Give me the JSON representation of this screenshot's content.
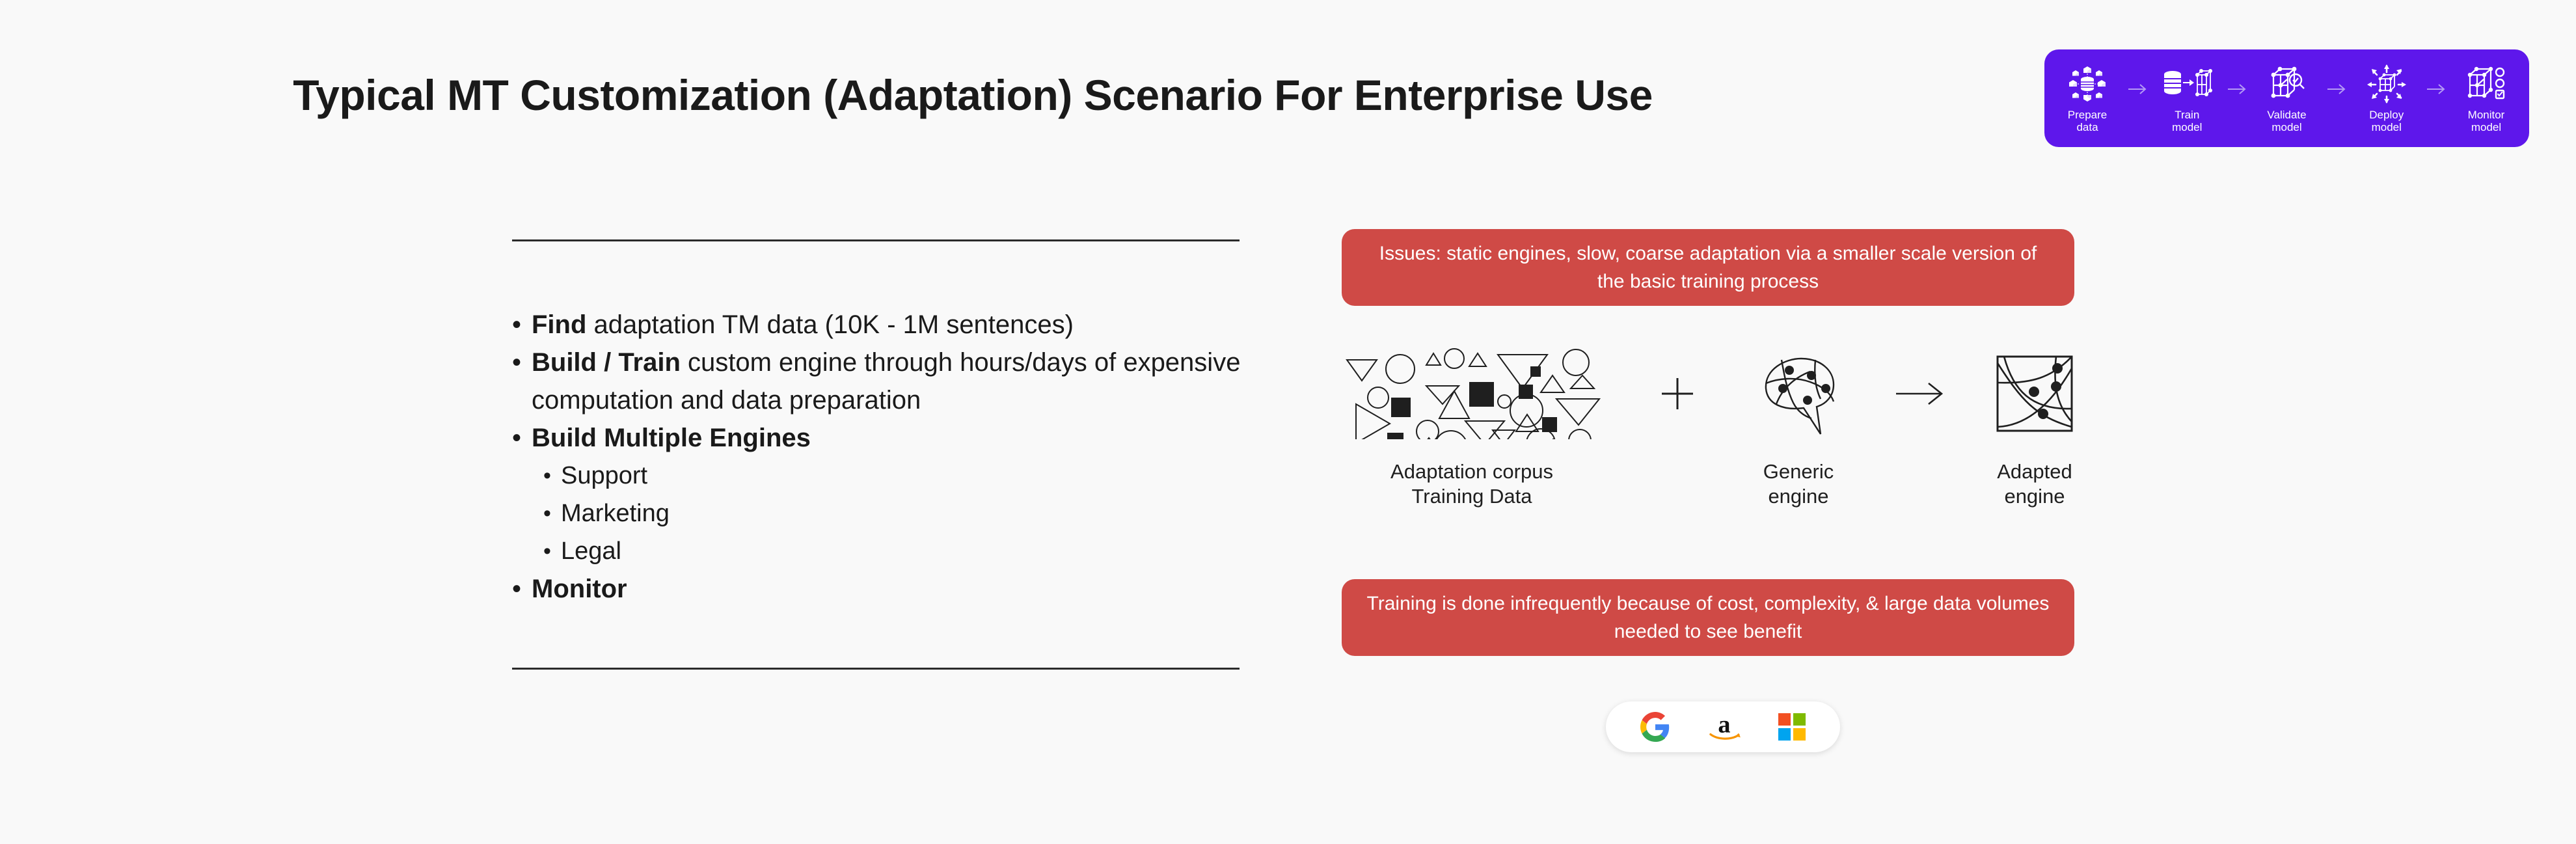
{
  "title": "Typical MT Customization (Adaptation) Scenario For Enterprise Use",
  "colors": {
    "background": "#f9f9f9",
    "badge_purple": "#5e17eb",
    "banner_red": "#cf4a46",
    "text_dark": "#1a1a1a",
    "rule": "#2b2b2b"
  },
  "pipeline": {
    "steps": [
      {
        "label": "Prepare\ndata",
        "icon": "prepare-data-icon"
      },
      {
        "label": "Train\nmodel",
        "icon": "train-model-icon"
      },
      {
        "label": "Validate\nmodel",
        "icon": "validate-model-icon"
      },
      {
        "label": "Deploy\nmodel",
        "icon": "deploy-model-icon"
      },
      {
        "label": "Monitor\nmodel",
        "icon": "monitor-model-icon"
      }
    ],
    "arrow_icon": "chevron-right-arrow-icon"
  },
  "bullets": [
    {
      "bold": "Find",
      "rest": " adaptation TM data (10K - 1M sentences)"
    },
    {
      "bold": "Build / Train",
      "rest": " custom engine through hours/days of expensive computation and data preparation"
    },
    {
      "bold": "Build Multiple Engines",
      "rest": ""
    },
    {
      "bold": "Monitor",
      "rest": ""
    }
  ],
  "sub_bullets": [
    "Support",
    "Marketing",
    "Legal"
  ],
  "banners": {
    "top": "Issues: static engines, slow, coarse adaptation via a smaller scale version of the basic training process",
    "bottom": "Training is done infrequently because of cost, complexity, & large data volumes needed to see benefit"
  },
  "flow": {
    "corpus_label": "Adaptation corpus\nTraining Data",
    "plus_symbol": "plus-icon",
    "generic_label": "Generic\nengine",
    "arrow_symbol": "right-arrow-icon",
    "adapted_label": "Adapted\nengine"
  },
  "vendors": [
    {
      "name": "google-logo"
    },
    {
      "name": "amazon-logo"
    },
    {
      "name": "microsoft-logo"
    }
  ]
}
